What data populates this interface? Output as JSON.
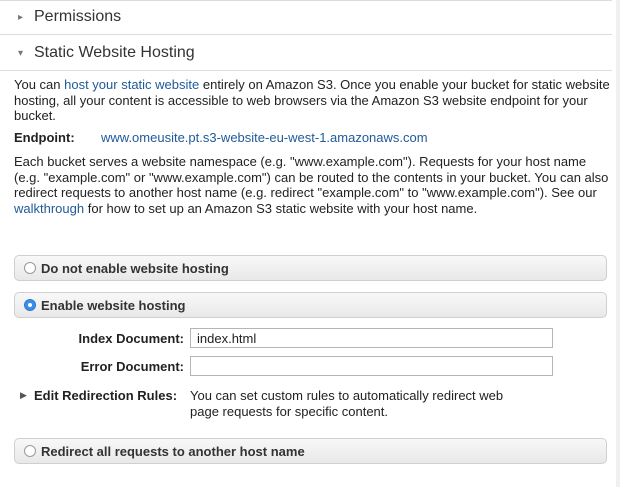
{
  "sections": {
    "permissions": "Permissions",
    "static_hosting": "Static Website Hosting"
  },
  "intro": {
    "pre": "You can ",
    "link": "host your static website",
    "post": " entirely on Amazon S3. Once you enable your bucket for static website hosting, all your content is accessible to web browsers via the Amazon S3 website endpoint for your bucket."
  },
  "endpoint": {
    "label": "Endpoint:",
    "url": "www.omeusite.pt.s3-website-eu-west-1.amazonaws.com"
  },
  "namespace": {
    "pre": "Each bucket serves a website namespace (e.g. \"www.example.com\"). Requests for your host name (e.g. \"example.com\" or \"www.example.com\") can be routed to the contents in your bucket. You can also redirect requests to another host name (e.g. redirect \"example.com\" to \"www.example.com\"). See our ",
    "link": "walkthrough",
    "post": " for how to set up an Amazon S3 static website with your host name."
  },
  "options": {
    "disable": "Do not enable website hosting",
    "enable": "Enable website hosting",
    "redirect_all": "Redirect all requests to another host name"
  },
  "fields": {
    "index_label": "Index Document:",
    "index_value": "index.html",
    "error_label": "Error Document:",
    "error_value": ""
  },
  "redirection": {
    "label": "Edit Redirection Rules:",
    "desc": "You can set custom rules to automatically redirect web page requests for specific content."
  }
}
